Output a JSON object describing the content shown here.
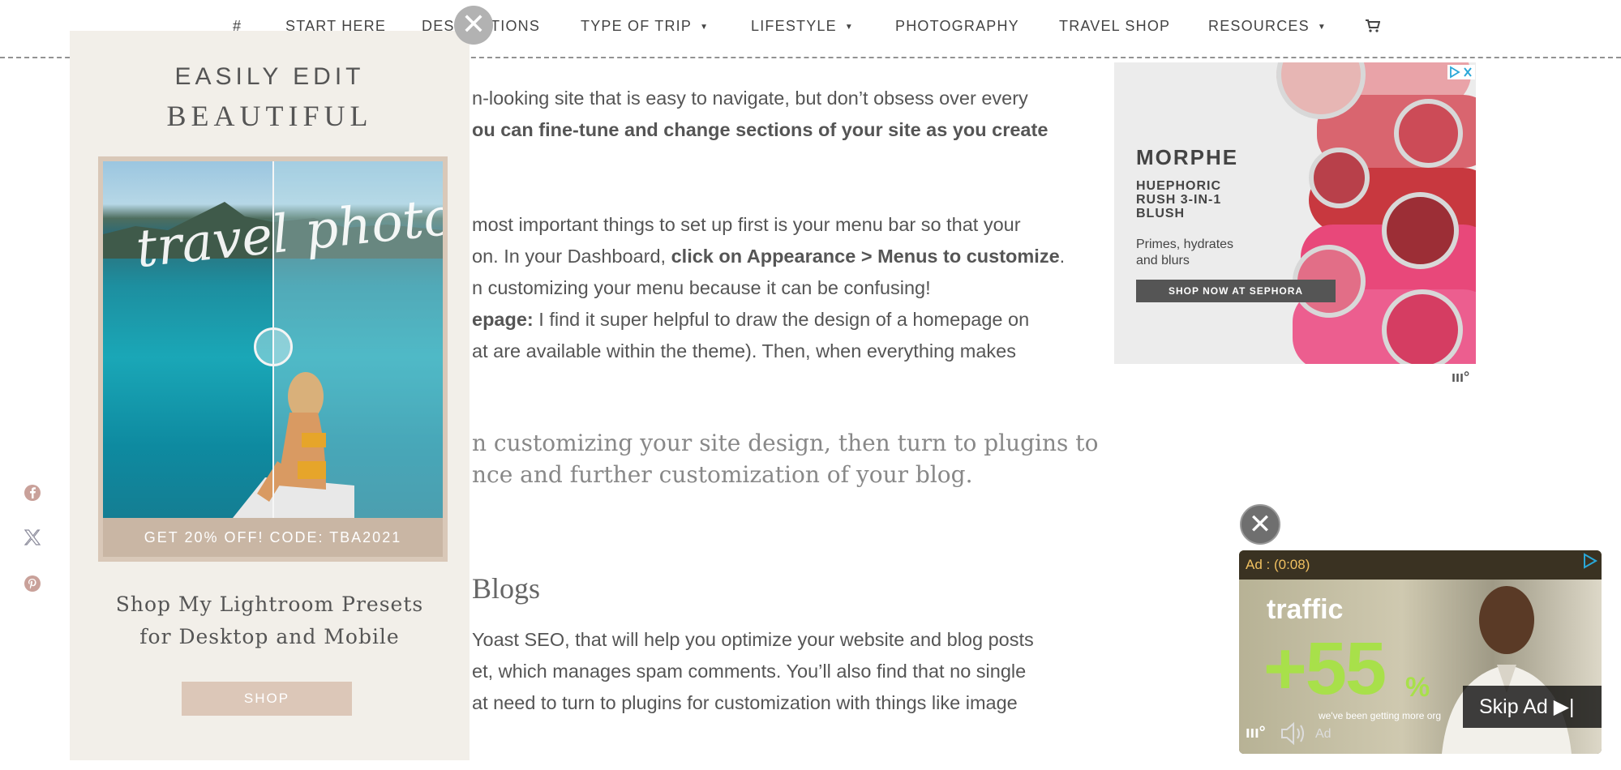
{
  "nav": {
    "items": [
      {
        "label": "#",
        "has_caret": false
      },
      {
        "label": "START HERE",
        "has_caret": false
      },
      {
        "label": "DESTINATIONS",
        "has_caret": false
      },
      {
        "label": "TYPE OF TRIP",
        "has_caret": true
      },
      {
        "label": "LIFESTYLE",
        "has_caret": true
      },
      {
        "label": "PHOTOGRAPHY",
        "has_caret": false
      },
      {
        "label": "TRAVEL SHOP",
        "has_caret": false
      },
      {
        "label": "RESOURCES",
        "has_caret": true
      }
    ],
    "cart_icon": "shopping-cart-icon",
    "caret_glyph": "▼"
  },
  "article": {
    "p1_line1": "n-looking site that is easy to navigate, but don’t obsess over every",
    "p1_line2": "ou can fine-tune and change sections of your site as you create",
    "p2_line1": " most important things to set up first is your menu bar so that your",
    "p2_line2_pre": "on. In your Dashboard, ",
    "p2_line2_bold": "click on Appearance > Menus to customize",
    "p2_line2_post": ".",
    "p2_line3": "n customizing your menu because it can be confusing!",
    "p2_line4_bold": "epage:",
    "p2_line4_rest": " I find it super helpful to draw the design of a homepage on",
    "p2_line5": "at are available within the theme). Then, when everything makes",
    "quote_line1": "n customizing your site design, then turn to plugins to",
    "quote_line2": "nce and further customization of your blog.",
    "heading": "Blogs",
    "p3_line1": "Yoast SEO, that will help you optimize your website and blog posts",
    "p3_line2": "et, which manages spam comments. You’ll also find that no single",
    "p3_line3": "at need to turn to plugins for customization with things like image"
  },
  "left_ad": {
    "title1": "EASILY EDIT",
    "title2": "BEAUTIFUL",
    "script_text": "travel photos",
    "promo": "GET 20% OFF! CODE: TBA2021",
    "shop_line1": "Shop My Lightroom Presets",
    "shop_line2": "for Desktop and Mobile",
    "shop_button": "SHOP",
    "close_glyph": "✕"
  },
  "social": {
    "icons": [
      "facebook-icon",
      "x-twitter-icon",
      "pinterest-icon"
    ]
  },
  "right_ad": {
    "brand": "MORPHE",
    "headline_1": "HUEPHORIC",
    "headline_2": "RUSH 3-IN-1",
    "headline_3": "BLUSH",
    "sub_1": "Primes, hydrates",
    "sub_2": "and blurs",
    "cta": "SHOP NOW AT SEPHORA",
    "swatch_label": "MORPHE",
    "mv_logo": "ııı°"
  },
  "video_ad": {
    "close_glyph": "✕",
    "timer": "Ad : (0:08)",
    "traffic": "traffic",
    "big_number": "+55",
    "percent": "%",
    "subtitle": "we've been getting more org",
    "skip": "Skip Ad ▶|",
    "ad_label": "Ad",
    "mv_mark": "ııı°"
  },
  "colors": {
    "accent_green": "#a8e04a",
    "promo_tan": "#c9b6a4",
    "shop_button": "#dcc7b8",
    "timer_gold": "#f0c060"
  }
}
